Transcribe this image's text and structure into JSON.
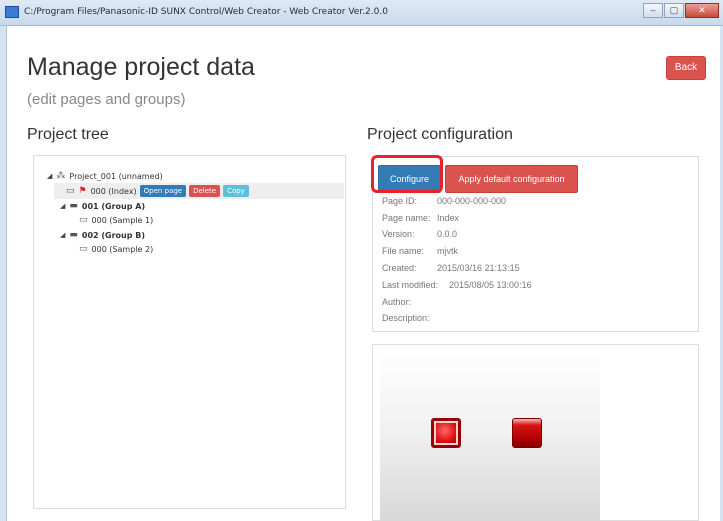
{
  "window": {
    "title": "C:/Program Files/Panasonic-ID SUNX Control/Web Creator - Web Creator Ver.2.0.0",
    "min": "–",
    "max": "▢",
    "close": "✕"
  },
  "page": {
    "title": "Manage project data",
    "subtitle": "(edit pages and groups)",
    "back_label": "Back"
  },
  "tree": {
    "heading": "Project tree",
    "project": "Project_001 (unnamed)",
    "selected_page": "000 (Index)",
    "actions": {
      "open": "Open page",
      "delete": "Delete",
      "copy": "Copy"
    },
    "group_a": "001 (Group A)",
    "group_a_page": "000 (Sample 1)",
    "group_b": "002 (Group B)",
    "group_b_page": "000 (Sample 2)"
  },
  "config": {
    "heading": "Project configuration",
    "configure_label": "Configure",
    "default_label": "Apply default configuration",
    "fields": [
      {
        "label": "Page ID:",
        "value": "000-000-000-000"
      },
      {
        "label": "Page name:",
        "value": "Index"
      },
      {
        "label": "Version:",
        "value": "0.0.0"
      },
      {
        "label": "File name:",
        "value": "mjvtk"
      },
      {
        "label": "Created:",
        "value": "2015/03/16 21:13:15"
      },
      {
        "label": "Last modified:",
        "value": "2015/08/05 13:00:16"
      },
      {
        "label": "Author:",
        "value": ""
      },
      {
        "label": "Description:",
        "value": ""
      }
    ]
  },
  "colors": {
    "primary": "#337ab7",
    "danger": "#d9534f",
    "info": "#5bc0de",
    "highlight": "#e8222a"
  },
  "icons": [
    "app-icon",
    "sitemap-icon",
    "monitor-icon",
    "flag-icon",
    "folder-icon",
    "caret-down-icon"
  ]
}
